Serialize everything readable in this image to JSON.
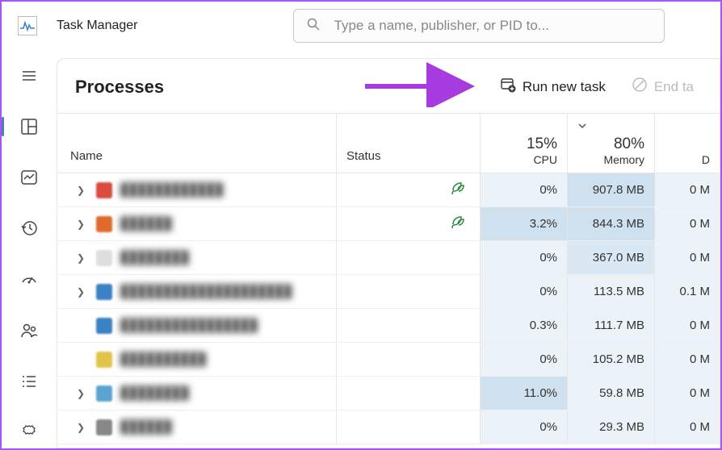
{
  "app": {
    "title": "Task Manager"
  },
  "search": {
    "placeholder": "Type a name, publisher, or PID to..."
  },
  "panel": {
    "title": "Processes",
    "run_new_task": "Run new task",
    "end_task": "End ta"
  },
  "columns": {
    "name": "Name",
    "status": "Status",
    "cpu_pct": "15%",
    "cpu_label": "CPU",
    "mem_pct": "80%",
    "mem_label": "Memory",
    "disk_label": "D"
  },
  "rows": [
    {
      "expandable": true,
      "iconColor": "#d94c3e",
      "name": "████████████",
      "eco": true,
      "cpu": "0%",
      "mem": "907.8 MB",
      "disk": "0 M",
      "cpuHeat": "heat3",
      "memHeat": "heat1"
    },
    {
      "expandable": true,
      "iconColor": "#e06a2b",
      "name": "██████",
      "eco": true,
      "cpu": "3.2%",
      "mem": "844.3 MB",
      "disk": "0 M",
      "cpuHeat": "heat1",
      "memHeat": "heat1"
    },
    {
      "expandable": true,
      "iconColor": "#dedede",
      "name": "████████",
      "eco": false,
      "cpu": "0%",
      "mem": "367.0 MB",
      "disk": "0 M",
      "cpuHeat": "heat3",
      "memHeat": "heat2"
    },
    {
      "expandable": true,
      "iconColor": "#3b82c4",
      "name": "████████████████████",
      "eco": false,
      "cpu": "0%",
      "mem": "113.5 MB",
      "disk": "0.1 M",
      "cpuHeat": "heat3",
      "memHeat": "heat3"
    },
    {
      "expandable": false,
      "iconColor": "#3b82c4",
      "name": "████████████████",
      "eco": false,
      "cpu": "0.3%",
      "mem": "111.7 MB",
      "disk": "0 M",
      "cpuHeat": "heat3",
      "memHeat": "heat3"
    },
    {
      "expandable": false,
      "iconColor": "#e0c34a",
      "name": "██████████",
      "eco": false,
      "cpu": "0%",
      "mem": "105.2 MB",
      "disk": "0 M",
      "cpuHeat": "heat3",
      "memHeat": "heat3"
    },
    {
      "expandable": true,
      "iconColor": "#5ba3d0",
      "name": "████████",
      "eco": false,
      "cpu": "11.0%",
      "mem": "59.8 MB",
      "disk": "0 M",
      "cpuHeat": "heat1",
      "memHeat": "heat3"
    },
    {
      "expandable": true,
      "iconColor": "#888888",
      "name": "██████",
      "eco": false,
      "cpu": "0%",
      "mem": "29.3 MB",
      "disk": "0 M",
      "cpuHeat": "heat3",
      "memHeat": "heat3"
    }
  ]
}
